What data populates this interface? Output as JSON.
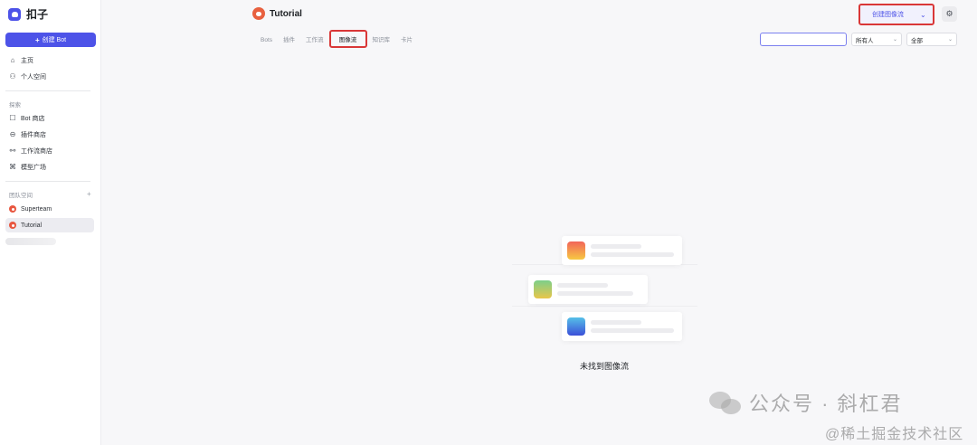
{
  "app": {
    "name": "扣子",
    "accent": "#4d53e8",
    "highlight": "#d93737"
  },
  "sidebar": {
    "create_bot_label": "创建 Bot",
    "main_items": [
      {
        "label": "主页",
        "icon": "home-icon"
      },
      {
        "label": "个人空间",
        "icon": "user-icon"
      }
    ],
    "explore_label": "探索",
    "explore_items": [
      {
        "label": "Bot 商店",
        "icon": "bot-icon"
      },
      {
        "label": "插件商店",
        "icon": "plugin-icon"
      },
      {
        "label": "工作流商店",
        "icon": "workflow-icon"
      },
      {
        "label": "模型广场",
        "icon": "model-icon"
      }
    ],
    "team_label": "团队空间",
    "teams": [
      {
        "label": "Superteam",
        "active": false
      },
      {
        "label": "Tutorial",
        "active": true
      }
    ]
  },
  "header": {
    "workspace_name": "Tutorial",
    "tabs": [
      "Bots",
      "插件",
      "工作流",
      "图像流",
      "知识库",
      "卡片"
    ],
    "active_tab": "图像流",
    "create_button_label": "创建图像流"
  },
  "filters": {
    "search_value": "",
    "owner_select": "所有人",
    "status_select": "全部"
  },
  "empty_state": {
    "message": "未找到图像流"
  },
  "watermark": {
    "line1": "公众号 · 斜杠君",
    "line2": "@稀土掘金技术社区"
  }
}
